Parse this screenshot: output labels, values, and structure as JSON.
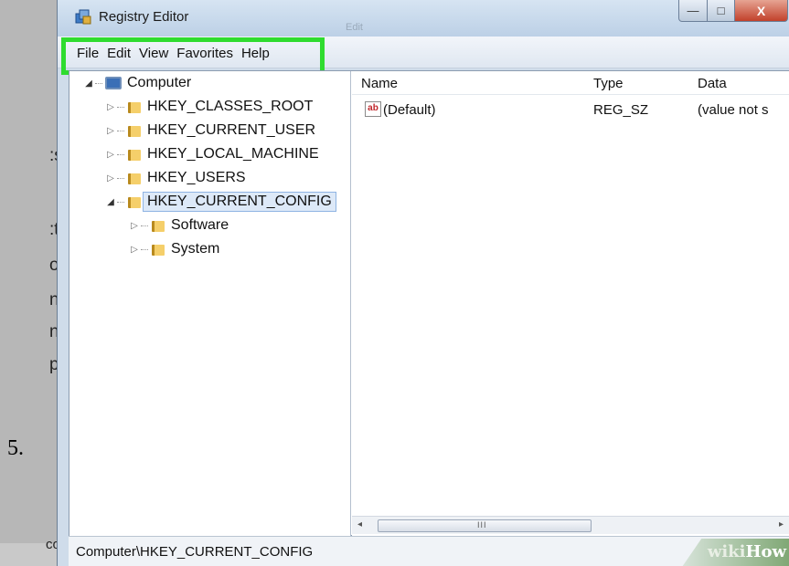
{
  "step_number": "5.",
  "background_fragments": [
    ":s",
    ":te",
    "or",
    "nd",
    "n f",
    "p",
    "co"
  ],
  "window": {
    "title": "Registry Editor",
    "ghost_tab": "Edit",
    "controls": {
      "minimize": "—",
      "maximize": "□",
      "close": "X"
    }
  },
  "menu": {
    "items": [
      "File",
      "Edit",
      "View",
      "Favorites",
      "Help"
    ],
    "highlight_color": "#2fdc2f"
  },
  "tree": {
    "root": "Computer",
    "items": [
      {
        "label": "HKEY_CLASSES_ROOT",
        "expanded": false
      },
      {
        "label": "HKEY_CURRENT_USER",
        "expanded": false
      },
      {
        "label": "HKEY_LOCAL_MACHINE",
        "expanded": false
      },
      {
        "label": "HKEY_USERS",
        "expanded": false
      },
      {
        "label": "HKEY_CURRENT_CONFIG",
        "expanded": true,
        "selected": true
      }
    ],
    "children": [
      "Software",
      "System"
    ]
  },
  "list": {
    "columns": [
      "Name",
      "Type",
      "Data"
    ],
    "rows": [
      {
        "name": "(Default)",
        "type": "REG_SZ",
        "data": "(value not s",
        "icon": "string-value-icon"
      }
    ]
  },
  "scrollbar": {
    "left": "◂",
    "grip": "III",
    "right": "▸"
  },
  "status": {
    "path": "Computer\\HKEY_CURRENT_CONFIG"
  },
  "watermark": {
    "part1": "wiki",
    "part2": "How"
  }
}
